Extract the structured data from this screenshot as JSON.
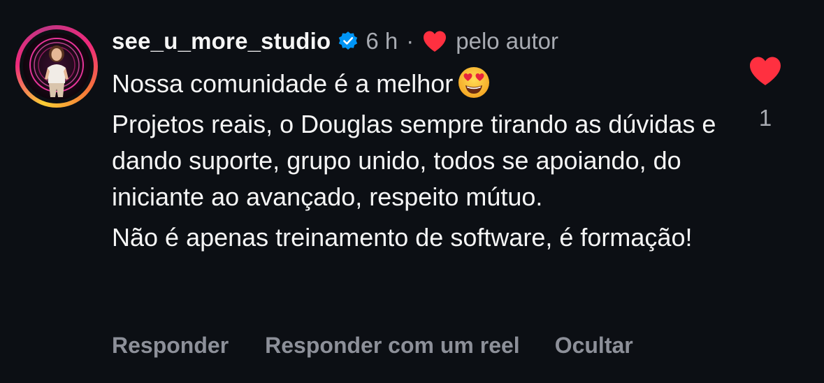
{
  "comment": {
    "username": "see_u_more_studio",
    "time": "6 h",
    "separator": "·",
    "liked_by_author_label": "pelo autor",
    "paragraphs": [
      "Nossa comunidade é a melhor",
      "Projetos reais, o Douglas sempre tirando as dúvidas e dando suporte, grupo unido, todos se apoiando, do iniciante ao avançado, respeito mútuo.",
      "Não é apenas treinamento de software, é formação!"
    ],
    "emoji": "heart-eyes-emoji",
    "like_count": "1",
    "actions": {
      "reply": "Responder",
      "reply_with_reel": "Responder com um reel",
      "hide": "Ocultar"
    }
  },
  "icons": {
    "verified": "verified-badge-icon",
    "author_heart": "heart-icon",
    "like": "heart-icon"
  },
  "colors": {
    "background": "#0c0f14",
    "text": "#f5f5f5",
    "muted": "#a8abb2",
    "action": "#8d9099",
    "heart": "#ff3040",
    "verified": "#0095f6",
    "ring_start": "#f9ce34",
    "ring_mid": "#ee2a7b",
    "ring_end": "#c13584"
  }
}
